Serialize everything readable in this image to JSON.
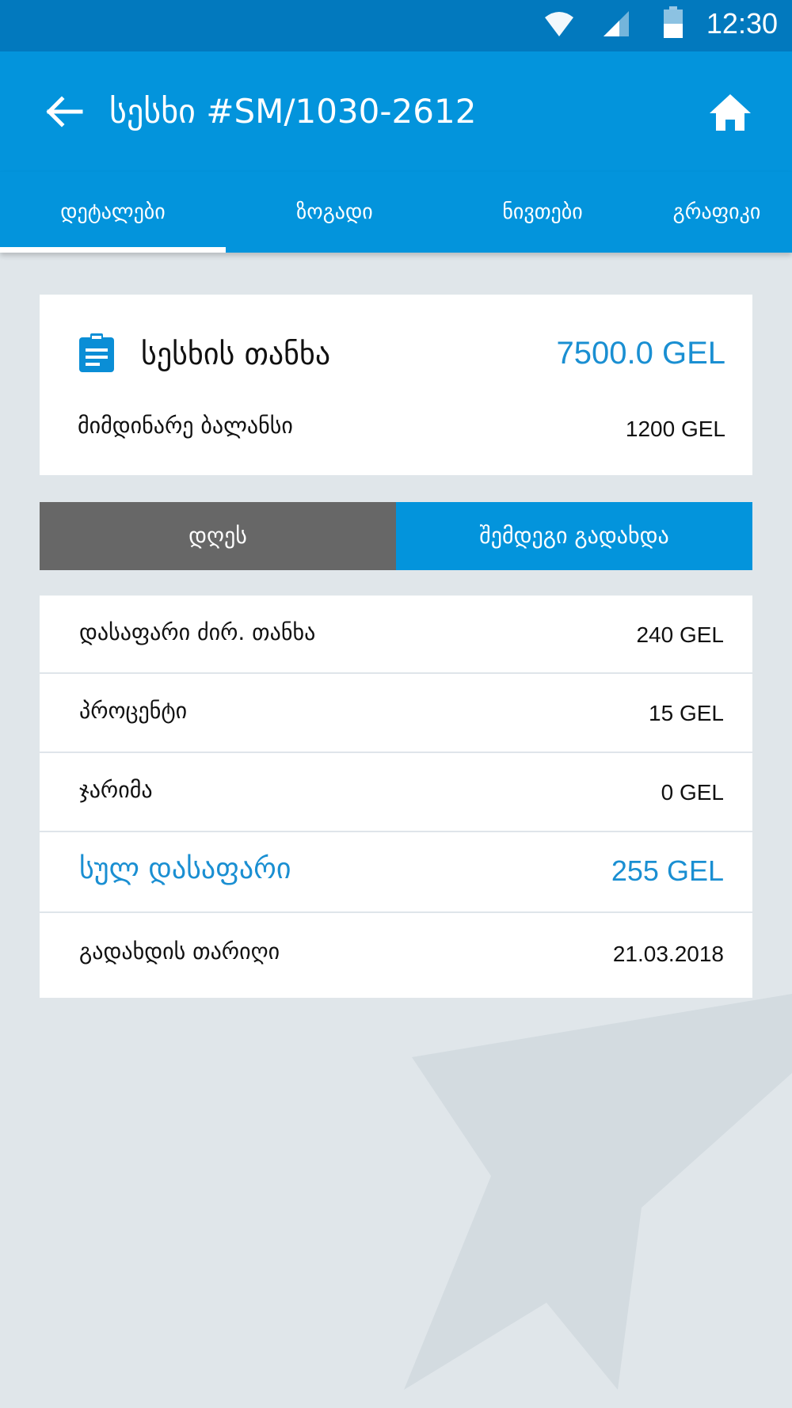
{
  "status_bar": {
    "time": "12:30",
    "icons": [
      "wifi-icon",
      "signal-icon",
      "battery-icon"
    ]
  },
  "app_bar": {
    "title": "სესხი #SM/1030-2612",
    "back_icon": "arrow-left-icon",
    "home_icon": "home-icon"
  },
  "tabs": [
    {
      "label": "დეტალები",
      "active": true
    },
    {
      "label": "ზოგადი",
      "active": false
    },
    {
      "label": "ნივთები",
      "active": false
    },
    {
      "label": "გრაფიკი",
      "active": false
    }
  ],
  "summary": {
    "icon": "clipboard-icon",
    "loan_amount_label": "სესხის თანხა",
    "loan_amount_value": "7500.0 GEL",
    "balance_label": "მიმდინარე ბალანსი",
    "balance_value": "1200 GEL"
  },
  "toggle": {
    "today_label": "დღეს",
    "next_payment_label": "შემდეგი გადახდა",
    "selected": "next_payment"
  },
  "details": [
    {
      "label": "დასაფარი ძირ. თანხა",
      "value": "240 GEL"
    },
    {
      "label": "პროცენტი",
      "value": "15 GEL"
    },
    {
      "label": "ჯარიმა",
      "value": "0 GEL"
    },
    {
      "label": "სულ დასაფარი",
      "value": "255 GEL"
    },
    {
      "label": "გადახდის თარიღი",
      "value": "21.03.2018"
    }
  ],
  "colors": {
    "status_bar": "#0279be",
    "primary": "#0394dc",
    "accent_text": "#1a8fd2",
    "toggle_inactive": "#676767",
    "background": "#e0e6ea"
  }
}
